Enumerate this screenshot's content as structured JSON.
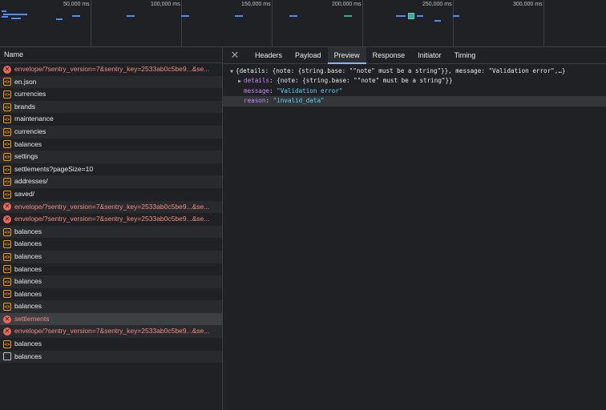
{
  "timeline": {
    "ticks": [
      "50,000 ms",
      "100,000 ms",
      "150,000 ms",
      "200,000 ms",
      "250,000 ms",
      "300,000 ms"
    ]
  },
  "requests_panel": {
    "column_name": "Name",
    "rows": [
      {
        "name": "envelope/?sentry_version=7&sentry_key=2533ab0c5be9...&se...",
        "type": "error"
      },
      {
        "name": "en.json",
        "type": "xhr"
      },
      {
        "name": "currencies",
        "type": "xhr"
      },
      {
        "name": "brands",
        "type": "xhr"
      },
      {
        "name": "maintenance",
        "type": "xhr"
      },
      {
        "name": "currencies",
        "type": "xhr"
      },
      {
        "name": "balances",
        "type": "xhr"
      },
      {
        "name": "settings",
        "type": "xhr"
      },
      {
        "name": "settlements?pageSize=10",
        "type": "xhr"
      },
      {
        "name": "addresses/",
        "type": "xhr"
      },
      {
        "name": "saved/",
        "type": "xhr"
      },
      {
        "name": "envelope/?sentry_version=7&sentry_key=2533ab0c5be9...&se...",
        "type": "error"
      },
      {
        "name": "envelope/?sentry_version=7&sentry_key=2533ab0c5be9...&se...",
        "type": "error"
      },
      {
        "name": "balances",
        "type": "xhr"
      },
      {
        "name": "balances",
        "type": "xhr"
      },
      {
        "name": "balances",
        "type": "xhr"
      },
      {
        "name": "balances",
        "type": "xhr"
      },
      {
        "name": "balances",
        "type": "xhr"
      },
      {
        "name": "balances",
        "type": "xhr"
      },
      {
        "name": "balances",
        "type": "xhr"
      },
      {
        "name": "settlements",
        "type": "error-selected"
      },
      {
        "name": "envelope/?sentry_version=7&sentry_key=2533ab0c5be9...&se...",
        "type": "error"
      },
      {
        "name": "balances",
        "type": "xhr"
      },
      {
        "name": "balances",
        "type": "doc"
      }
    ]
  },
  "details_panel": {
    "close_icon": "close-icon",
    "tabs": [
      "Headers",
      "Payload",
      "Preview",
      "Response",
      "Initiator",
      "Timing"
    ],
    "active_tab": "Preview",
    "preview": {
      "summary": "{details: {note: {string.base: \"\"note\" must be a string\"}}, message: \"Validation error\",…}",
      "details_key": "details",
      "details_value": "{note: {string.base: \"\"note\" must be a string\"}}",
      "message_key": "message",
      "message_value": "\"Validation error\"",
      "reason_key": "reason",
      "reason_value": "\"invalid_data\""
    }
  },
  "colors": {
    "error": "#ee675c",
    "xhr": "#f29900",
    "string": "#5cd5fb",
    "active_tab_underline": "#8ab4f8"
  }
}
